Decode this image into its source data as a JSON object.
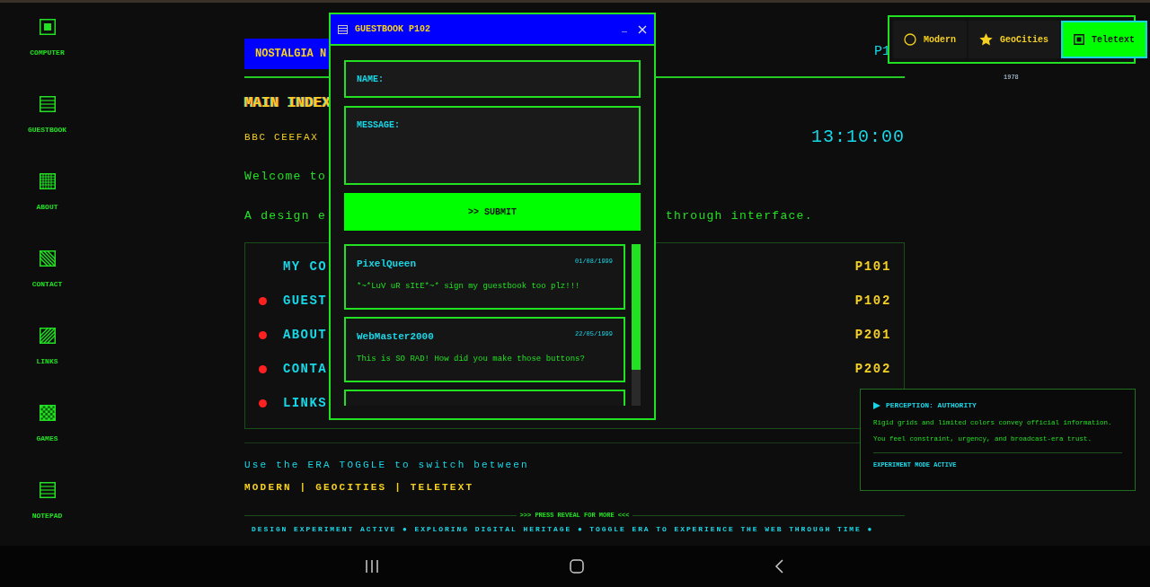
{
  "sidebar": {
    "items": [
      {
        "label": "COMPUTER",
        "kind": "filled"
      },
      {
        "label": "GUESTBOOK",
        "kind": "lines"
      },
      {
        "label": "ABOUT",
        "kind": "grid"
      },
      {
        "label": "CONTACT",
        "kind": "diagonal"
      },
      {
        "label": "LINKS",
        "kind": "hatch"
      },
      {
        "label": "GAMES",
        "kind": "checker"
      },
      {
        "label": "NOTEPAD",
        "kind": "lines"
      }
    ]
  },
  "header": {
    "title": "NOSTALGIA N",
    "page": "P1"
  },
  "heading": "MAIN INDEX",
  "service": "BBC CEEFAX",
  "clock": "13:10:00",
  "welcome": "Welcome to",
  "tagline": {
    "start": "A design e",
    "end": "through interface."
  },
  "menu": [
    {
      "label": "MY CO",
      "bullet": false,
      "page": "P101"
    },
    {
      "label": "GUEST",
      "bullet": true,
      "page": "P102"
    },
    {
      "label": "ABOUT",
      "bullet": true,
      "page": "P201"
    },
    {
      "label": "CONTA",
      "bullet": true,
      "page": "P202"
    },
    {
      "label": "LINKS",
      "bullet": true
    }
  ],
  "hint": "Use the ERA TOGGLE to switch between",
  "eras_line": "MODERN | GEOCITIES | TELETEXT",
  "reveal": ">>> PRESS REVEAL FOR MORE <<<",
  "ticker": "DESIGN EXPERIMENT ACTIVE ● EXPLORING DIGITAL HERITAGE ● TOGGLE ERA TO EXPERIENCE THE WEB THROUGH TIME ●",
  "dialog": {
    "title": "GUESTBOOK P102",
    "minimize": "_",
    "name_placeholder": "NAME:",
    "message_placeholder": "MESSAGE:",
    "submit": ">> SUBMIT",
    "entries": [
      {
        "name": "PixelQueen",
        "date": "01/08/1999",
        "message": "*~*LuV uR sItE*~* sign my guestbook too plz!!!"
      },
      {
        "name": "WebMaster2000",
        "date": "22/05/1999",
        "message": "This is SO RAD! How did you make those buttons?"
      }
    ]
  },
  "era_toggle": {
    "options": [
      {
        "label": "Modern",
        "kind": "circle",
        "selected": false
      },
      {
        "label": "GeoCities",
        "kind": "star",
        "selected": false
      },
      {
        "label": "Teletext",
        "kind": "square",
        "selected": true
      }
    ],
    "year": "1978"
  },
  "perception": {
    "title": "PERCEPTION: AUTHORITY",
    "lines": [
      "Rigid grids and limited colors convey official information.",
      "You feel constraint, urgency, and broadcast-era trust."
    ],
    "footer": "EXPERIMENT MODE ACTIVE"
  }
}
